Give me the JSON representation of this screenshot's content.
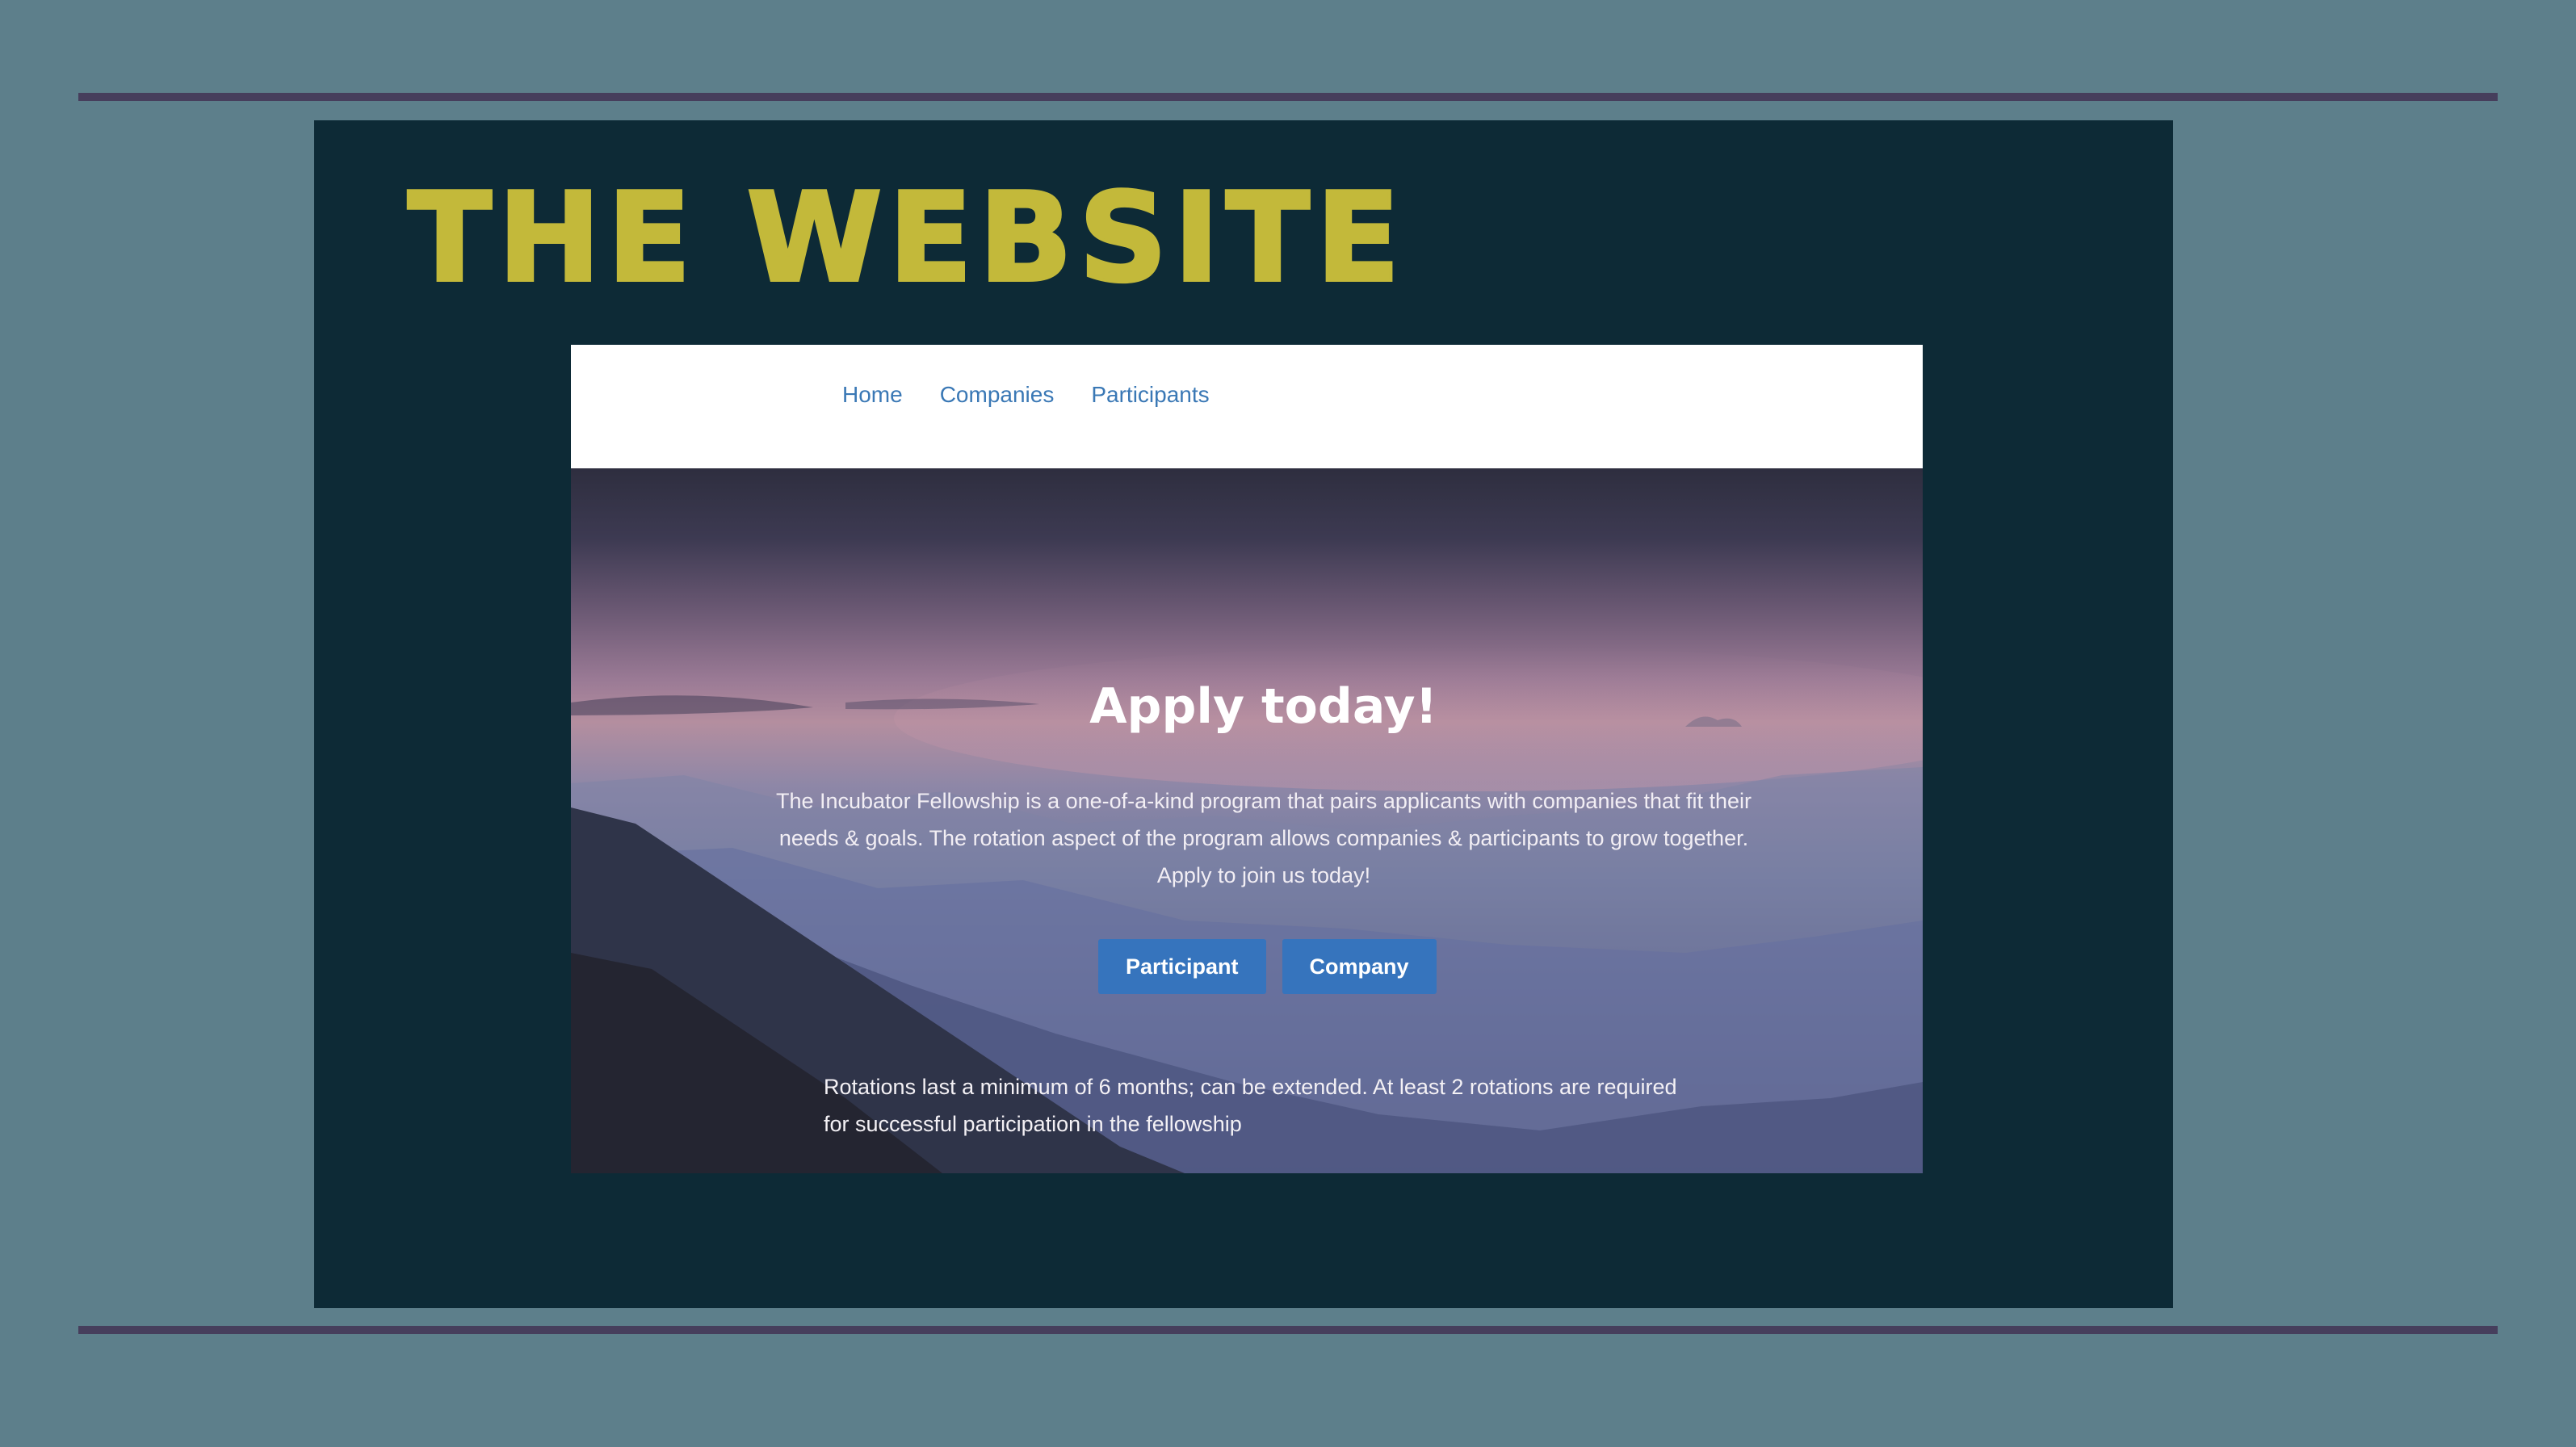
{
  "site": {
    "title": "THE WEBSITE"
  },
  "nav": {
    "items": [
      {
        "label": "Home"
      },
      {
        "label": "Companies"
      },
      {
        "label": "Participants"
      }
    ]
  },
  "hero": {
    "heading": "Apply today!",
    "description": "The Incubator Fellowship is a one-of-a-kind program that pairs applicants with companies that fit their needs & goals. The rotation aspect of the program allows companies & participants to grow together. Apply to join us today!",
    "buttons": {
      "participant": "Participant",
      "company": "Company"
    },
    "note": "Rotations last a minimum of 6 months; can be extended. At least 2 rotations are required for successful participation in the fellowship"
  },
  "colors": {
    "page_background": "#5d7f8b",
    "rule": "#463e5c",
    "panel": "#0d2a36",
    "title": "#c3b93a",
    "nav_link": "#3a78b5",
    "button": "#3674bd"
  }
}
